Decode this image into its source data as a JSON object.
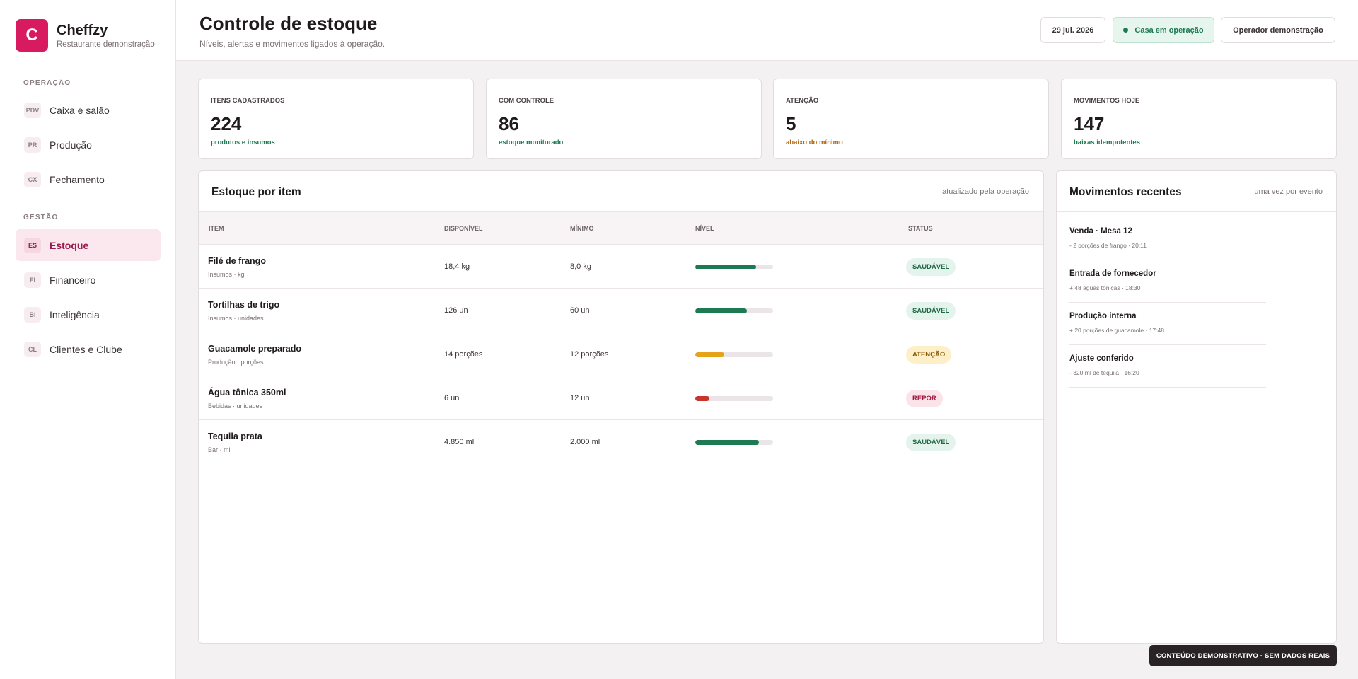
{
  "brand": {
    "logo_letter": "C",
    "name": "Cheffzy",
    "subtitle": "Restaurante demonstração",
    "color": "#d81b60"
  },
  "sidebar": {
    "sections": [
      {
        "title": "OPERAÇÃO",
        "items": [
          {
            "code": "PDV",
            "label": "Caixa e salão",
            "active": false
          },
          {
            "code": "PR",
            "label": "Produção",
            "active": false
          },
          {
            "code": "CX",
            "label": "Fechamento",
            "active": false
          }
        ]
      },
      {
        "title": "GESTÃO",
        "items": [
          {
            "code": "ES",
            "label": "Estoque",
            "active": true
          },
          {
            "code": "FI",
            "label": "Financeiro",
            "active": false
          },
          {
            "code": "BI",
            "label": "Inteligência",
            "active": false
          },
          {
            "code": "CL",
            "label": "Clientes e Clube",
            "active": false
          }
        ]
      }
    ]
  },
  "header": {
    "title": "Controle de estoque",
    "subtitle": "Níveis, alertas e movimentos ligados à operação.",
    "date": "29 jul. 2026",
    "status": "Casa em operação",
    "operator": "Operador demonstração"
  },
  "kpis": [
    {
      "label": "ITENS CADASTRADOS",
      "value": "224",
      "note": "produtos e insumos",
      "tone": "ok"
    },
    {
      "label": "COM CONTROLE",
      "value": "86",
      "note": "estoque monitorado",
      "tone": "ok"
    },
    {
      "label": "ATENÇÃO",
      "value": "5",
      "note": "abaixo do mínimo",
      "tone": "warn"
    },
    {
      "label": "MOVIMENTOS HOJE",
      "value": "147",
      "note": "baixas idempotentes",
      "tone": "ok"
    }
  ],
  "stock_panel": {
    "title": "Estoque por item",
    "meta": "atualizado pela operação",
    "columns": [
      "ITEM",
      "DISPONÍVEL",
      "MÍNIMO",
      "NÍVEL",
      "STATUS"
    ],
    "rows": [
      {
        "name": "Filé de frango",
        "sub": "Insumos · kg",
        "available": "18,4 kg",
        "minimum": "8,0 kg",
        "level": 0.78,
        "status": "SAUDÁVEL",
        "tone": "ok"
      },
      {
        "name": "Tortilhas de trigo",
        "sub": "Insumos · unidades",
        "available": "126 un",
        "minimum": "60 un",
        "level": 0.66,
        "status": "SAUDÁVEL",
        "tone": "ok"
      },
      {
        "name": "Guacamole preparado",
        "sub": "Produção · porções",
        "available": "14 porções",
        "minimum": "12 porções",
        "level": 0.37,
        "status": "ATENÇÃO",
        "tone": "warn"
      },
      {
        "name": "Água tônica 350ml",
        "sub": "Bebidas · unidades",
        "available": "6 un",
        "minimum": "12 un",
        "level": 0.18,
        "status": "REPOR",
        "tone": "bad"
      },
      {
        "name": "Tequila prata",
        "sub": "Bar · ml",
        "available": "4.850 ml",
        "minimum": "2.000 ml",
        "level": 0.82,
        "status": "SAUDÁVEL",
        "tone": "ok"
      }
    ]
  },
  "movements_panel": {
    "title": "Movimentos recentes",
    "meta": "uma vez por evento",
    "items": [
      {
        "title": "Venda · Mesa 12",
        "sub": "- 2 porções de frango · 20:11"
      },
      {
        "title": "Entrada de fornecedor",
        "sub": "+ 48 águas tônicas · 18:30"
      },
      {
        "title": "Produção interna",
        "sub": "+ 20 porções de guacamole · 17:48"
      },
      {
        "title": "Ajuste conferido",
        "sub": "- 320 ml de tequila · 16:20"
      }
    ]
  },
  "footer_banner": "CONTEÚDO DEMONSTRATIVO · SEM DADOS REAIS",
  "colors": {
    "ok": "#1e7a52",
    "warn": "#e6a219",
    "bad": "#c9342f",
    "accent": "#d81b60"
  }
}
